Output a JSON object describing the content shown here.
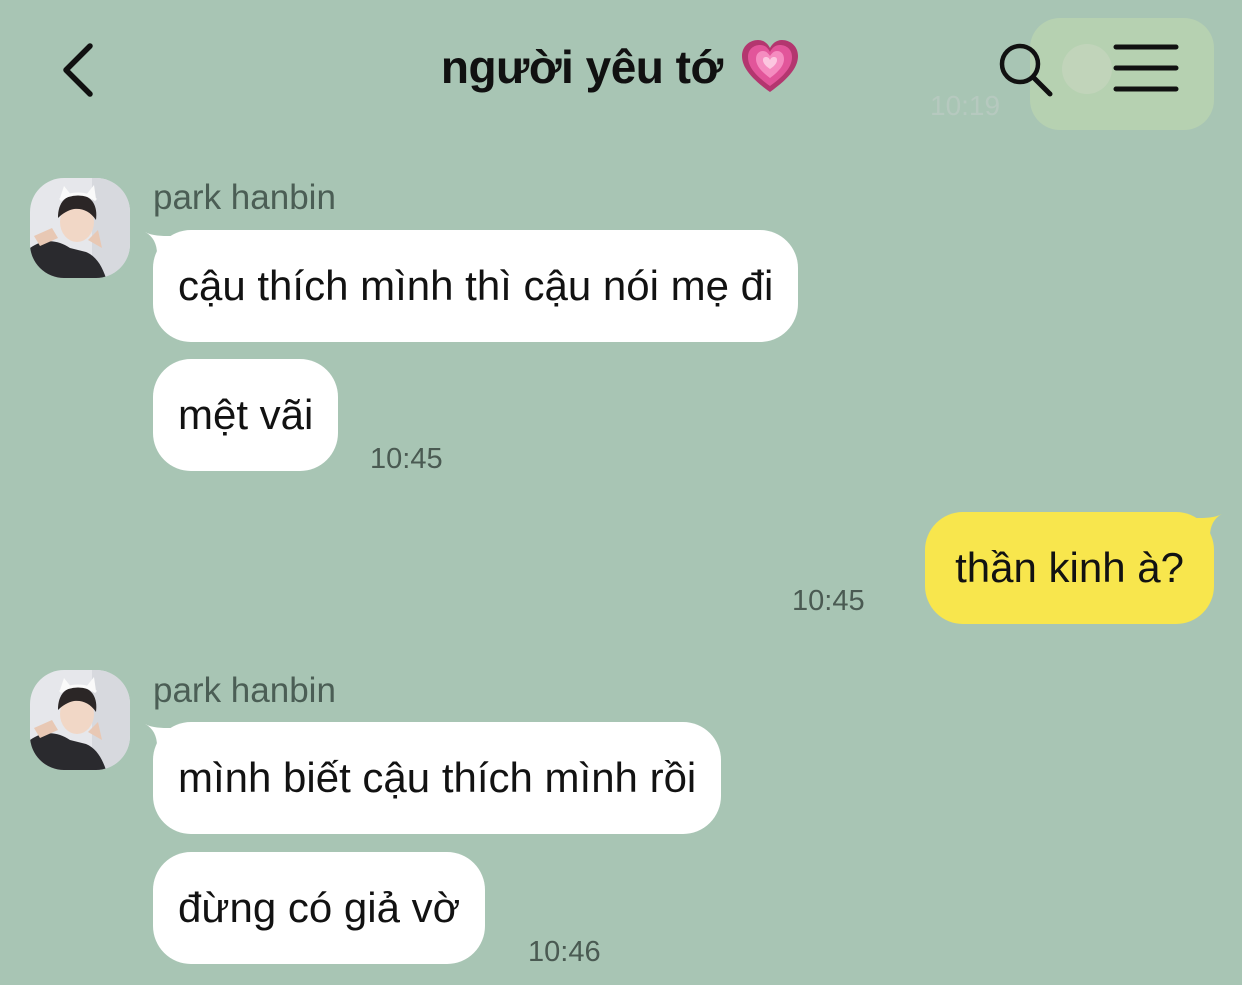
{
  "header": {
    "title": "người yêu tớ",
    "title_emoji": "growing-heart-emoji",
    "back_icon": "chevron-left-icon",
    "search_icon": "search-icon",
    "menu_icon": "hamburger-menu-icon",
    "ghost_time": "10:19"
  },
  "colors": {
    "background": "#a8c5b4",
    "incoming_bubble": "#ffffff",
    "outgoing_bubble": "#f8e64d",
    "heart": "#e2559a"
  },
  "messages": [
    {
      "sender": "park hanbin",
      "direction": "incoming",
      "lines": [
        "cậu thích mình thì cậu nói mẹ đi",
        "mệt vãi"
      ],
      "time": "10:45"
    },
    {
      "sender": "me",
      "direction": "outgoing",
      "lines": [
        "thần kinh à?"
      ],
      "time": "10:45"
    },
    {
      "sender": "park hanbin",
      "direction": "incoming",
      "lines": [
        "mình biết cậu thích mình rồi",
        "đừng có giả vờ"
      ],
      "time": "10:46"
    }
  ]
}
